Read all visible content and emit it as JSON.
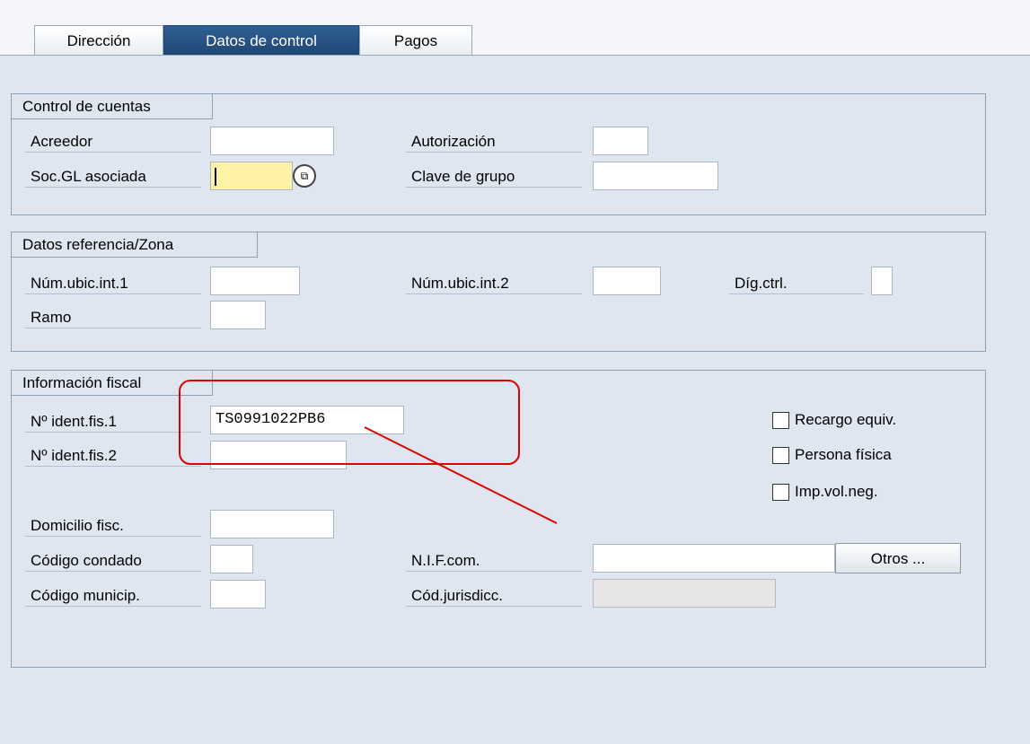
{
  "tabs": [
    {
      "label": "Dirección"
    },
    {
      "label": "Datos de control"
    },
    {
      "label": "Pagos"
    }
  ],
  "account_control": {
    "title": "Control de cuentas",
    "vendor_label": "Acreedor",
    "vendor_value": "",
    "gl_company_label": "Soc.GL asociada",
    "gl_company_value": "",
    "authorization_label": "Autorización",
    "authorization_value": "",
    "group_key_label": "Clave de grupo",
    "group_key_value": ""
  },
  "reference_data": {
    "title": "Datos referencia/Zona",
    "location1_label": "Núm.ubic.int.1",
    "location1_value": "",
    "location2_label": "Núm.ubic.int.2",
    "location2_value": "",
    "check_digit_label": "Díg.ctrl.",
    "check_digit_value": "",
    "industry_label": "Ramo",
    "industry_value": ""
  },
  "tax_info": {
    "title": "Información fiscal",
    "tax_number1_label": "Nº ident.fis.1",
    "tax_number1_value": "TS0991022PB6",
    "tax_number2_label": "Nº ident.fis.2",
    "tax_number2_value": "",
    "equalization_tax_label": "Recargo equiv.",
    "natural_person_label": "Persona física",
    "sales_tax_label": "Imp.vol.neg.",
    "tax_office_label": "Domicilio fisc.",
    "tax_office_value": "",
    "county_code_label": "Código condado",
    "county_code_value": "",
    "city_code_label": "Código municip.",
    "city_code_value": "",
    "vat_reg_label": "N.I.F.com.",
    "vat_reg_value": "",
    "other_button_label": "Otros ...",
    "jurisdiction_label": "Cód.jurisdicc.",
    "jurisdiction_value": ""
  },
  "colors": {
    "background": "#dfe6ef",
    "active_tab": "#1f4674",
    "focus_field": "#fff3a8",
    "annotation": "#e00000"
  }
}
